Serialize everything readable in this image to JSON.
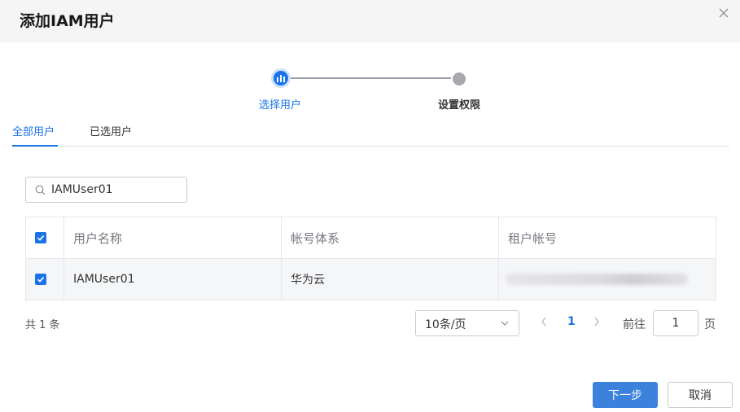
{
  "dialog": {
    "title": "添加IAM用户"
  },
  "steps": [
    {
      "label": "选择用户",
      "state": "active"
    },
    {
      "label": "设置权限",
      "state": "pending"
    }
  ],
  "tabs": [
    {
      "label": "全部用户",
      "active": true
    },
    {
      "label": "已选用户",
      "active": false
    }
  ],
  "search": {
    "value": "IAMUser01",
    "icon": "search-icon"
  },
  "table": {
    "columns": [
      "用户名称",
      "帐号体系",
      "租户帐号"
    ],
    "header_checked": true,
    "rows": [
      {
        "checked": true,
        "user_name": "IAMUser01",
        "account_system": "华为云",
        "tenant_account": ""
      }
    ]
  },
  "pagination": {
    "total_text": "共 1 条",
    "page_size": "10条/页",
    "current_page": "1",
    "goto_label": "前往",
    "goto_value": "1",
    "goto_unit": "页"
  },
  "buttons": {
    "next": "下一步",
    "cancel": "取消"
  },
  "colors": {
    "accent": "#1a73e8",
    "primary_button": "#3c82dd",
    "header_bg": "#f5f5f6"
  }
}
